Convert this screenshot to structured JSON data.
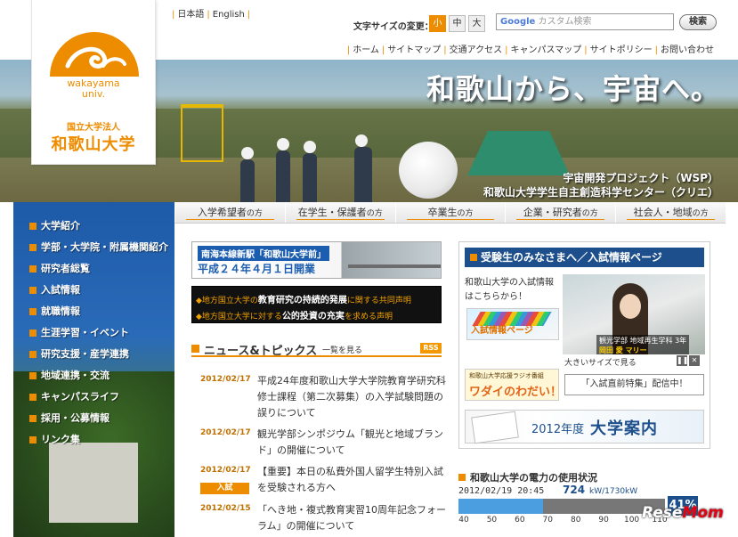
{
  "logo": {
    "en_line1": "wakayama",
    "en_line2": "univ.",
    "jp_small": "国立大学法人",
    "jp_name": "和歌山大学"
  },
  "language": {
    "items": [
      "日本語",
      "English"
    ]
  },
  "font_size": {
    "label": "文字サイズの変更：",
    "options": [
      "小",
      "中",
      "大"
    ],
    "selected": "小"
  },
  "search": {
    "google": "Google",
    "placeholder": "カスタム検索",
    "button": "検索"
  },
  "top_nav": [
    "ホーム",
    "サイトマップ",
    "交通アクセス",
    "キャンパスマップ",
    "サイトポリシー",
    "お問い合わせ"
  ],
  "hero": {
    "title": "和歌山から、宇宙へ。",
    "subtitle1": "宇宙開発プロジェクト（WSP）",
    "subtitle2": "和歌山大学学生自主創造科学センター（クリエ）"
  },
  "audience_tabs": [
    {
      "label": "入学希望者",
      "suffix": "の方"
    },
    {
      "label": "在学生・保護者",
      "suffix": "の方"
    },
    {
      "label": "卒業生",
      "suffix": "の方"
    },
    {
      "label": "企業・研究者",
      "suffix": "の方"
    },
    {
      "label": "社会人・地域",
      "suffix": "の方"
    }
  ],
  "sidebar": {
    "items": [
      "大学紹介",
      "学部・大学院・附属機関紹介",
      "研究者総覧",
      "入試情報",
      "就職情報",
      "生涯学習・イベント",
      "研究支援・産学連携",
      "地域連携・交流",
      "キャンパスライフ",
      "採用・公募情報",
      "リンク集"
    ]
  },
  "banner_station": {
    "line1": "南海本線新駅「和歌山大学前」",
    "line2": "平成２４年４月１日開業"
  },
  "banner_statement": {
    "l1_a": "◆地方国立大学の",
    "l1_b": "教育研究の持続的発展",
    "l1_c": "に関する共同声明",
    "l2_a": "◆地方国立大学に対する",
    "l2_b": "公的投資の充実",
    "l2_c": "を求める声明"
  },
  "news": {
    "title": "ニュース&トピックス",
    "more": "一覧を見る",
    "rss": "RSS",
    "items": [
      {
        "date": "2012/02/17",
        "text": "平成24年度和歌山大学大学院教育学研究科修士課程（第二次募集）の入学試験問題の誤りについて",
        "badge": ""
      },
      {
        "date": "2012/02/17",
        "text": "観光学部シンポジウム「観光と地域ブランド」の開催について",
        "badge": ""
      },
      {
        "date": "2012/02/17",
        "text": "【重要】本日の私費外国人留学生特別入試を受験される方へ",
        "badge": "入試"
      },
      {
        "date": "2012/02/15",
        "text": "「へき地・複式教育実習10周年記念フォーラム」の開催について",
        "badge": ""
      }
    ]
  },
  "exam_panel": {
    "title": "受験生のみなさまへ／入試情報ページ",
    "desc": "和歌山大学の入試情報はこちらから！",
    "link_label": "入試情報ページ",
    "photo_caption_a": "観光学部 地域再生学科 3年",
    "photo_caption_b": "岡田 愛 マリー",
    "big_size": "大きいサイズで見る",
    "radio_top": "和歌山大学応援ラジオ番組",
    "radio_name": "ワダイのわだい！",
    "radio_msg": "「入試直前特集」配信中！",
    "guide_year": "2012年度",
    "guide_name": "大学案内"
  },
  "power": {
    "title": "和歌山大学の電力の使用状況",
    "timestamp": "2012/02/19 20:45",
    "value": "724",
    "unit": "kW/1730kW",
    "percent": "41%",
    "fraction": 0.41,
    "ticks": [
      "40",
      "50",
      "60",
      "70",
      "80",
      "90",
      "100",
      "110"
    ]
  },
  "watermark": {
    "a": "Rese",
    "b": "Mom"
  },
  "colors": {
    "accent": "#ee8c00",
    "navy": "#1c4f8c",
    "blue": "#1c5db0"
  }
}
